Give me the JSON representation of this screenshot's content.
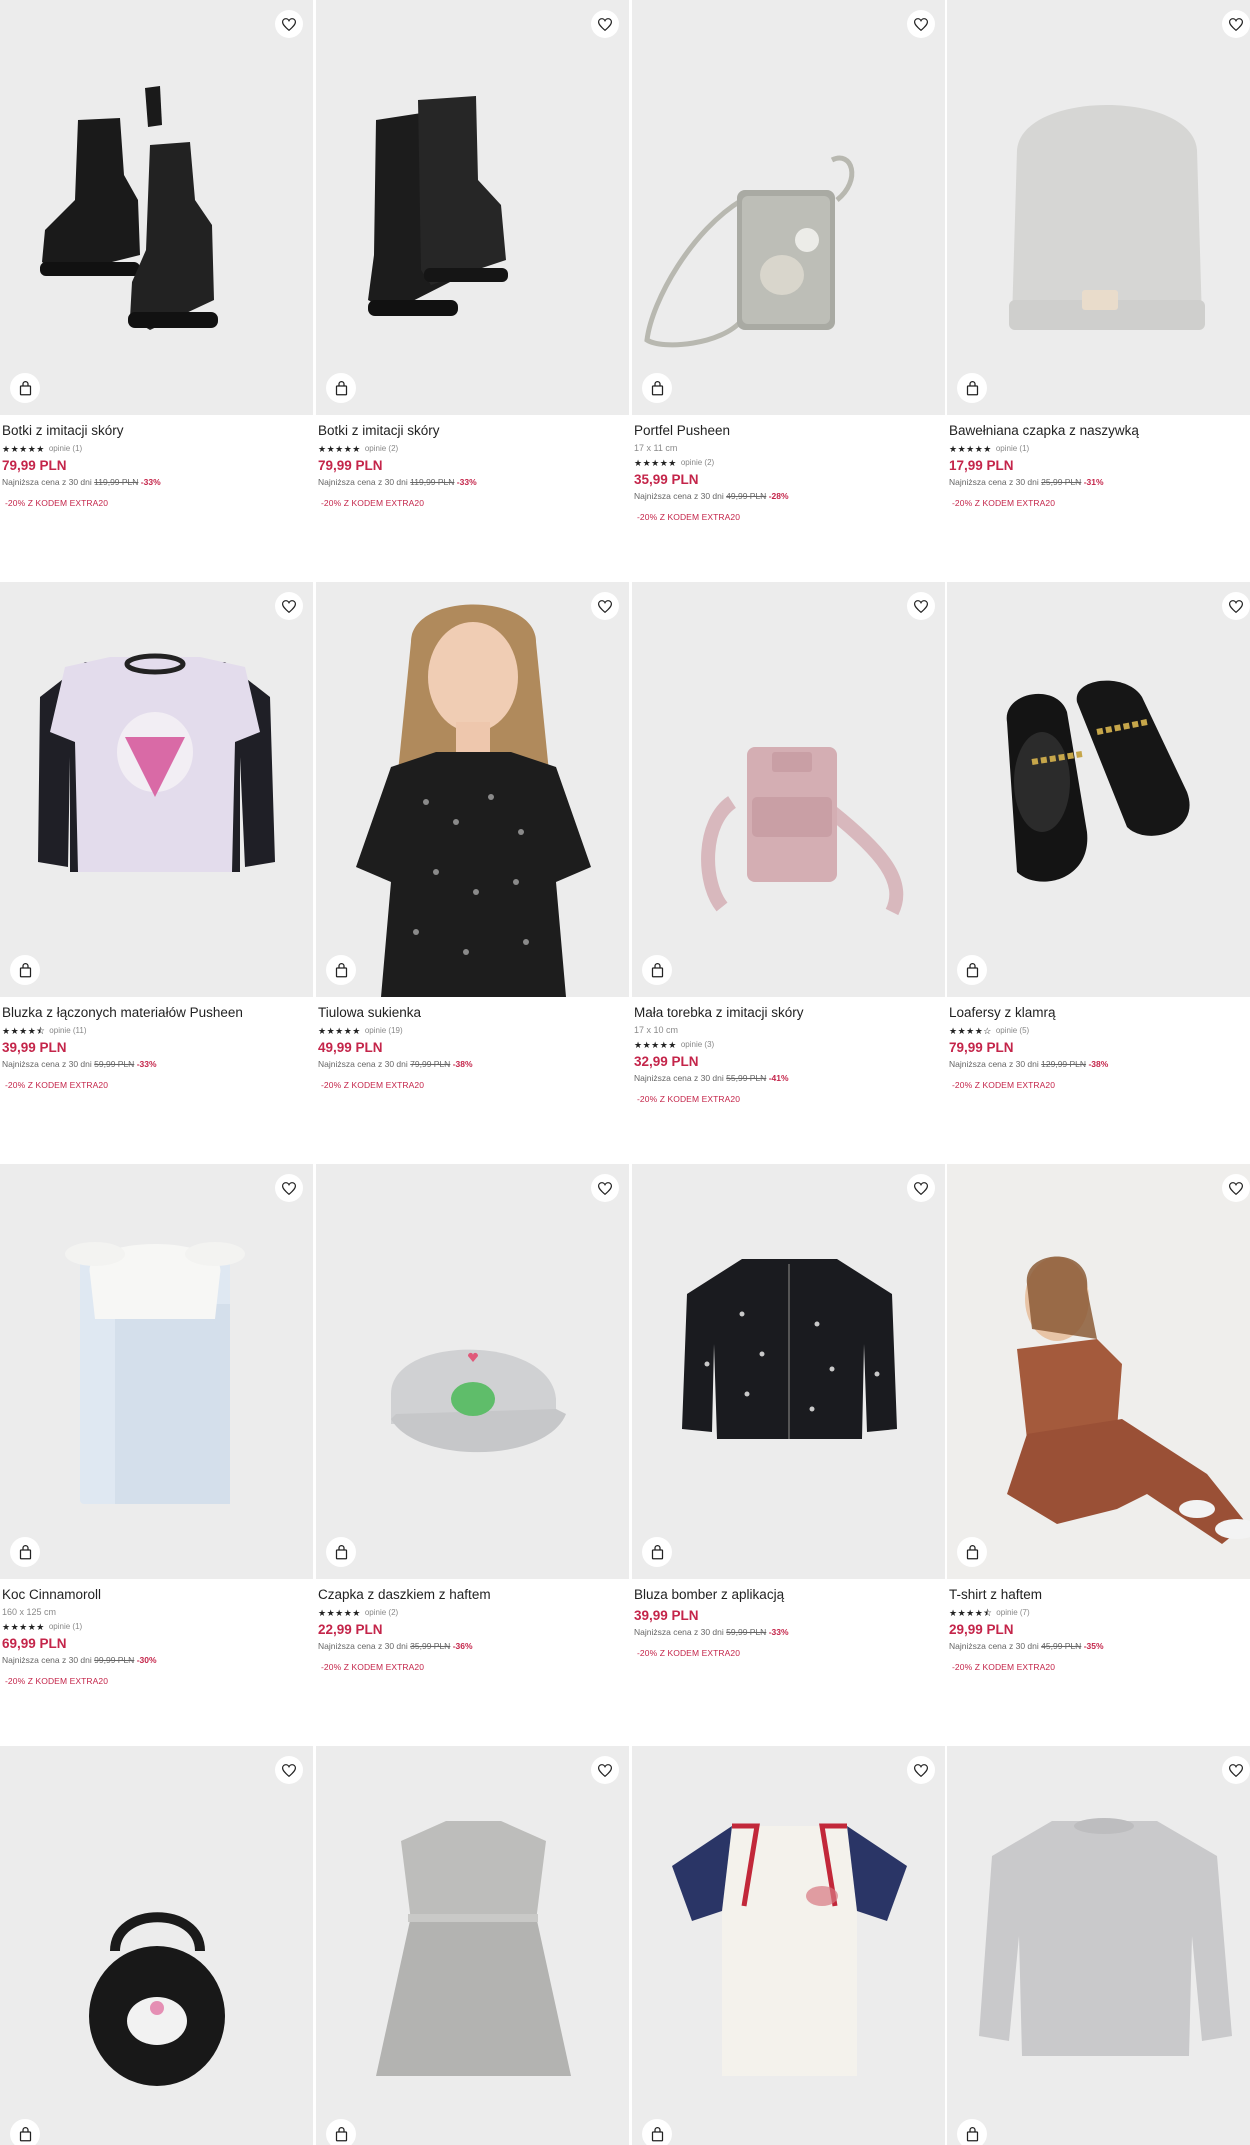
{
  "products": [
    {
      "name": "Botki z imitacji skóry",
      "dims": "",
      "stars": "★★★★★",
      "reviews": "opinie (1)",
      "price": "79,99 PLN",
      "lowest_label": "Najniższa cena z 30 dni",
      "old_price": "119,99 PLN",
      "discount": "-33%",
      "promo": "-20% Z KODEM EXTRA20",
      "image": "black-lace-up-boots"
    },
    {
      "name": "Botki z imitacji skóry",
      "dims": "",
      "stars": "★★★★★",
      "reviews": "opinie (2)",
      "price": "79,99 PLN",
      "lowest_label": "Najniższa cena z 30 dni",
      "old_price": "119,99 PLN",
      "discount": "-33%",
      "promo": "-20% Z KODEM EXTRA20",
      "image": "black-ankle-boots"
    },
    {
      "name": "Portfel Pusheen",
      "dims": "17 x 11 cm",
      "stars": "★★★★★",
      "reviews": "opinie (2)",
      "price": "35,99 PLN",
      "lowest_label": "Najniższa cena z 30 dni",
      "old_price": "49,99 PLN",
      "discount": "-28%",
      "promo": "-20% Z KODEM EXTRA20",
      "image": "pusheen-phone-wallet"
    },
    {
      "name": "Bawełniana czapka z naszywką",
      "dims": "",
      "stars": "★★★★★",
      "reviews": "opinie (1)",
      "price": "17,99 PLN",
      "lowest_label": "Najniższa cena z 30 dni",
      "old_price": "25,99 PLN",
      "discount": "-31%",
      "promo": "-20% Z KODEM EXTRA20",
      "image": "grey-beanie"
    },
    {
      "name": "Bluzka z łączonych materiałów Pusheen",
      "dims": "",
      "stars": "★★★★⯪",
      "reviews": "opinie (11)",
      "price": "39,99 PLN",
      "lowest_label": "Najniższa cena z 30 dni",
      "old_price": "59,99 PLN",
      "discount": "-33%",
      "promo": "-20% Z KODEM EXTRA20",
      "image": "pusheen-long-sleeve"
    },
    {
      "name": "Tiulowa sukienka",
      "dims": "",
      "stars": "★★★★★",
      "reviews": "opinie (19)",
      "price": "49,99 PLN",
      "lowest_label": "Najniższa cena z 30 dni",
      "old_price": "79,99 PLN",
      "discount": "-38%",
      "promo": "-20% Z KODEM EXTRA20",
      "image": "girl-tulle-dress"
    },
    {
      "name": "Mała torebka z imitacji skóry",
      "dims": "17 x 10 cm",
      "stars": "★★★★★",
      "reviews": "opinie (3)",
      "price": "32,99 PLN",
      "lowest_label": "Najniższa cena z 30 dni",
      "old_price": "55,99 PLN",
      "discount": "-41%",
      "promo": "-20% Z KODEM EXTRA20",
      "image": "pink-crossbody-bag"
    },
    {
      "name": "Loafersy z klamrą",
      "dims": "",
      "stars": "★★★★☆",
      "reviews": "opinie (5)",
      "price": "79,99 PLN",
      "lowest_label": "Najniższa cena z 30 dni",
      "old_price": "129,99 PLN",
      "discount": "-38%",
      "promo": "-20% Z KODEM EXTRA20",
      "image": "black-loafers"
    },
    {
      "name": "Koc Cinnamoroll",
      "dims": "160 x 125 cm",
      "stars": "★★★★★",
      "reviews": "opinie (1)",
      "price": "69,99 PLN",
      "lowest_label": "Najniższa cena z 30 dni",
      "old_price": "99,99 PLN",
      "discount": "-30%",
      "promo": "-20% Z KODEM EXTRA20",
      "image": "cinnamoroll-blanket"
    },
    {
      "name": "Czapka z daszkiem z haftem",
      "dims": "",
      "stars": "★★★★★",
      "reviews": "opinie (2)",
      "price": "22,99 PLN",
      "lowest_label": "Najniższa cena z 30 dni",
      "old_price": "35,99 PLN",
      "discount": "-36%",
      "promo": "-20% Z KODEM EXTRA20",
      "image": "frog-cap"
    },
    {
      "name": "Bluza bomber z aplikacją",
      "dims": "",
      "stars": "",
      "reviews": "",
      "price": "39,99 PLN",
      "lowest_label": "Najniższa cena z 30 dni",
      "old_price": "59,99 PLN",
      "discount": "-33%",
      "promo": "-20% Z KODEM EXTRA20",
      "image": "bomber-jacket"
    },
    {
      "name": "T-shirt z haftem",
      "dims": "",
      "stars": "★★★★⯪",
      "reviews": "opinie (7)",
      "price": "29,99 PLN",
      "lowest_label": "Najniższa cena z 30 dni",
      "old_price": "45,99 PLN",
      "discount": "-35%",
      "promo": "-20% Z KODEM EXTRA20",
      "image": "girl-brown-set"
    },
    {
      "name": "",
      "dims": "",
      "stars": "",
      "reviews": "",
      "price": "",
      "lowest_label": "",
      "old_price": "",
      "discount": "",
      "promo": "",
      "image": "kuromi-bag"
    },
    {
      "name": "",
      "dims": "",
      "stars": "",
      "reviews": "",
      "price": "",
      "lowest_label": "",
      "old_price": "",
      "discount": "",
      "promo": "",
      "image": "grey-tulle-dress"
    },
    {
      "name": "",
      "dims": "",
      "stars": "",
      "reviews": "",
      "price": "",
      "lowest_label": "",
      "old_price": "",
      "discount": "",
      "promo": "",
      "image": "varsity-tshirt"
    },
    {
      "name": "",
      "dims": "",
      "stars": "",
      "reviews": "",
      "price": "",
      "lowest_label": "",
      "old_price": "",
      "discount": "",
      "promo": "",
      "image": "grey-sweatshirt"
    }
  ],
  "colors": {
    "price": "#c4254a",
    "image_bg": "#ececec"
  },
  "icons": {
    "favorite": "heart-icon",
    "add_to_cart": "shopping-bag-icon"
  }
}
